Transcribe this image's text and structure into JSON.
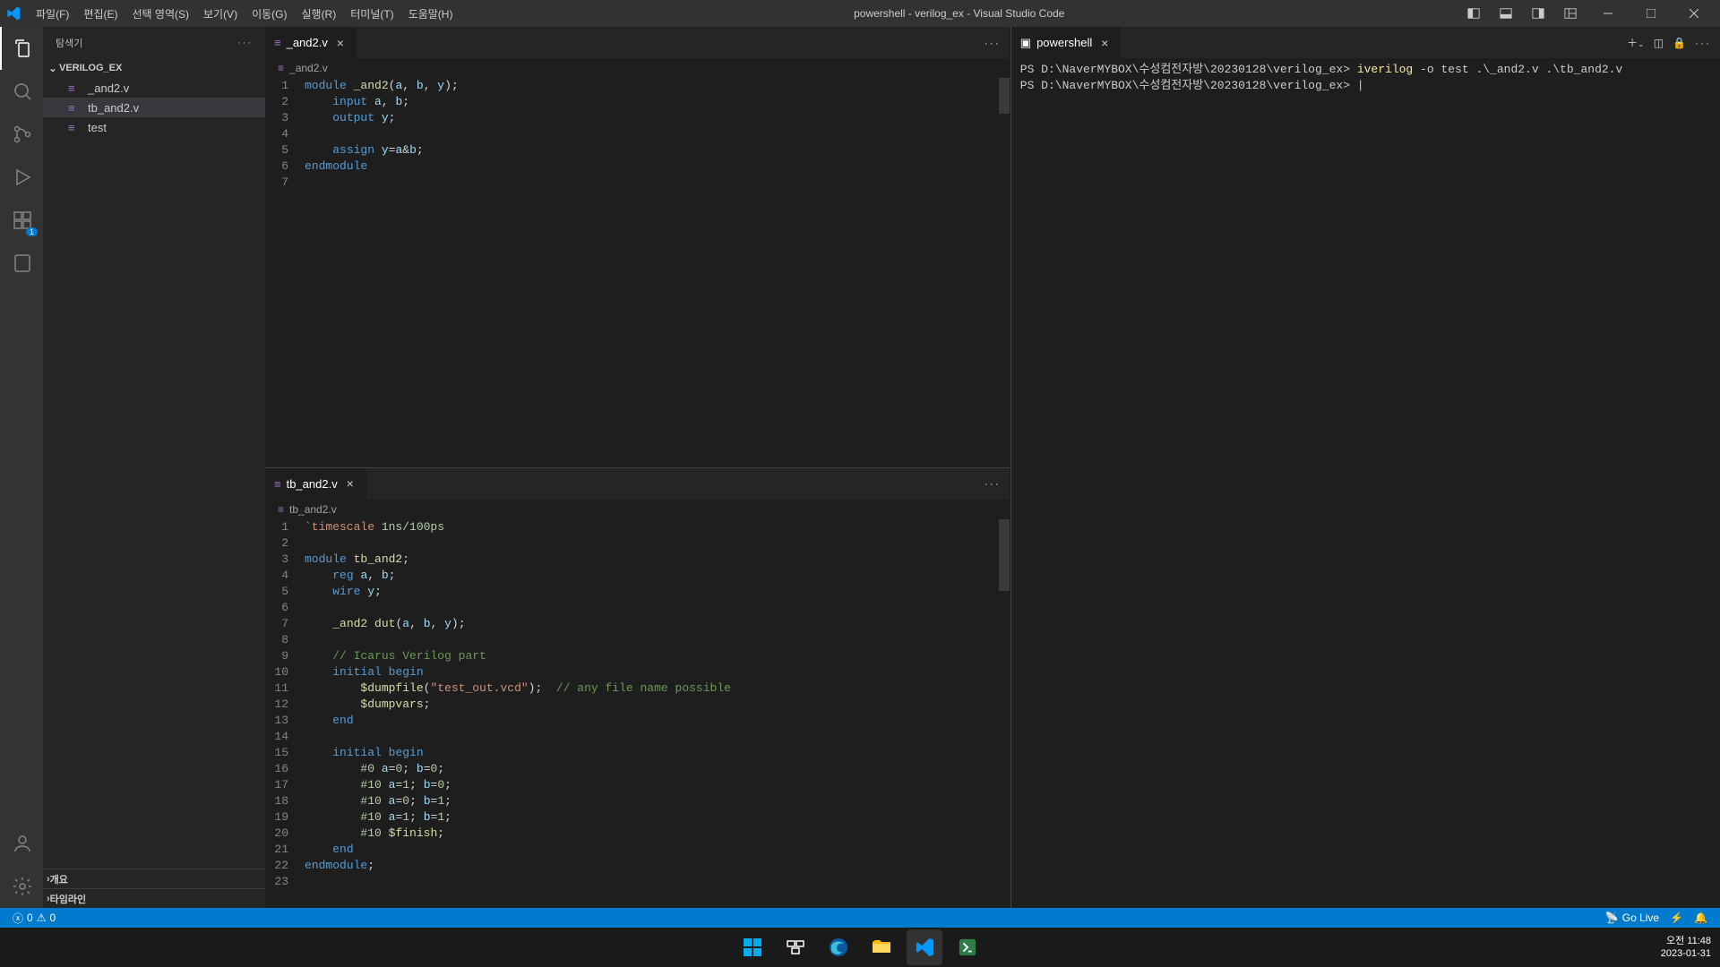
{
  "titlebar": {
    "menus": [
      "파일(F)",
      "편집(E)",
      "선택 영역(S)",
      "보기(V)",
      "이동(G)",
      "실행(R)",
      "터미널(T)",
      "도움말(H)"
    ],
    "title": "powershell - verilog_ex - Visual Studio Code"
  },
  "sidebar": {
    "header": "탐색기",
    "project": "VERILOG_EX",
    "files": [
      {
        "name": "_and2.v",
        "selected": false
      },
      {
        "name": "tb_and2.v",
        "selected": true
      },
      {
        "name": "test",
        "selected": false
      }
    ],
    "collapsed": [
      "개요",
      "타임라인"
    ]
  },
  "editors": {
    "topLeft": {
      "tab": "_and2.v",
      "crumb": "_and2.v",
      "lines": [
        {
          "n": "1",
          "html": "<span class='kw'>module</span> <span class='fn'>_and2</span>(<span class='id'>a</span>, <span class='id'>b</span>, <span class='id'>y</span>);"
        },
        {
          "n": "2",
          "html": "    <span class='kw'>input</span> <span class='id'>a</span>, <span class='id'>b</span>;"
        },
        {
          "n": "3",
          "html": "    <span class='kw'>output</span> <span class='id'>y</span>;"
        },
        {
          "n": "4",
          "html": ""
        },
        {
          "n": "5",
          "html": "    <span class='kw'>assign</span> <span class='id'>y</span>=<span class='id'>a</span>&amp;<span class='id'>b</span>;"
        },
        {
          "n": "6",
          "html": "<span class='kw'>endmodule</span>"
        },
        {
          "n": "7",
          "html": ""
        }
      ]
    },
    "bottomLeft": {
      "tab": "tb_and2.v",
      "crumb": "tb_and2.v",
      "lines": [
        {
          "n": "1",
          "html": "<span class='str'>`timescale</span> <span class='num'>1ns/100ps</span>"
        },
        {
          "n": "2",
          "html": ""
        },
        {
          "n": "3",
          "html": "<span class='kw'>module</span> <span class='fn'>tb_and2</span>;"
        },
        {
          "n": "4",
          "html": "    <span class='kw'>reg</span> <span class='id'>a</span>, <span class='id'>b</span>;"
        },
        {
          "n": "5",
          "html": "    <span class='kw'>wire</span> <span class='id'>y</span>;"
        },
        {
          "n": "6",
          "html": ""
        },
        {
          "n": "7",
          "html": "    <span class='fn'>_and2</span> <span class='fn'>dut</span>(<span class='id'>a</span>, <span class='id'>b</span>, <span class='id'>y</span>);"
        },
        {
          "n": "8",
          "html": ""
        },
        {
          "n": "9",
          "html": "    <span class='cm'>// Icarus Verilog part</span>"
        },
        {
          "n": "10",
          "html": "    <span class='kw'>initial</span> <span class='kw'>begin</span>"
        },
        {
          "n": "11",
          "html": "        <span class='fn'>$dumpfile</span>(<span class='str'>\"test_out.vcd\"</span>);  <span class='cm'>// any file name possible</span>"
        },
        {
          "n": "12",
          "html": "        <span class='fn'>$dumpvars</span>;"
        },
        {
          "n": "13",
          "html": "    <span class='kw'>end</span>"
        },
        {
          "n": "14",
          "html": ""
        },
        {
          "n": "15",
          "html": "    <span class='kw'>initial</span> <span class='kw'>begin</span>"
        },
        {
          "n": "16",
          "html": "        <span class='num'>#0</span> <span class='id'>a</span>=<span class='num'>0</span>; <span class='id'>b</span>=<span class='num'>0</span>;"
        },
        {
          "n": "17",
          "html": "        <span class='num'>#10</span> <span class='id'>a</span>=<span class='num'>1</span>; <span class='id'>b</span>=<span class='num'>0</span>;"
        },
        {
          "n": "18",
          "html": "        <span class='num'>#10</span> <span class='id'>a</span>=<span class='num'>0</span>; <span class='id'>b</span>=<span class='num'>1</span>;"
        },
        {
          "n": "19",
          "html": "        <span class='num'>#10</span> <span class='id'>a</span>=<span class='num'>1</span>; <span class='id'>b</span>=<span class='num'>1</span>;"
        },
        {
          "n": "20",
          "html": "        <span class='num'>#10</span> <span class='fn'>$finish</span>;"
        },
        {
          "n": "21",
          "html": "    <span class='kw'>end</span>"
        },
        {
          "n": "22",
          "html": "<span class='kw'>endmodule</span>;"
        },
        {
          "n": "23",
          "html": ""
        }
      ]
    },
    "right": {
      "tab": "powershell",
      "termLines": [
        {
          "html": "<span class='term-prompt'>PS D:\\NaverMYBOX\\수성컴전자방\\20230128\\verilog_ex&gt;</span> <span class='term-cmd'>iverilog</span> -o test .\\_and2.v .\\tb_and2.v"
        },
        {
          "html": "<span class='term-prompt'>PS D:\\NaverMYBOX\\수성컴전자방\\20230128\\verilog_ex&gt;</span> |"
        }
      ]
    }
  },
  "statusbar": {
    "errors": "0",
    "warnings": "0",
    "golive": "Go Live"
  },
  "taskbar": {
    "time": "오전 11:48",
    "date": "2023-01-31"
  }
}
